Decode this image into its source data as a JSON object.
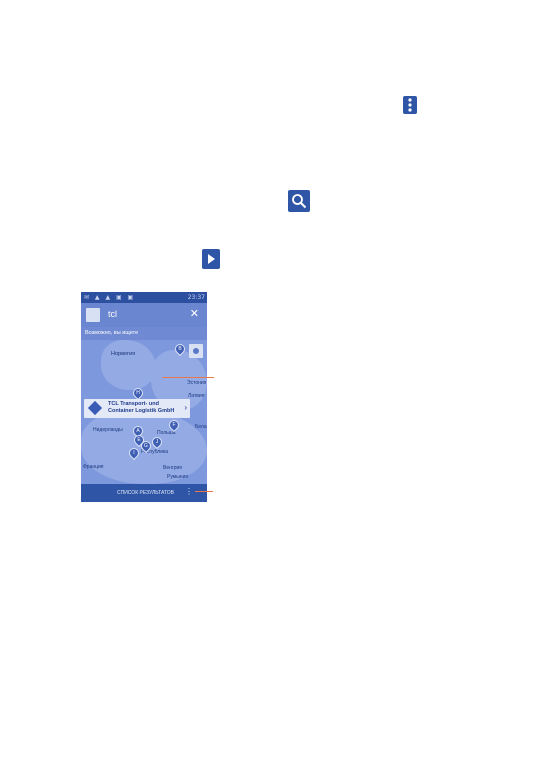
{
  "colors": {
    "accent": "#2f56a6",
    "map_water": "#7d98dc",
    "map_land": "#93aae4",
    "callout": "#e8784a"
  },
  "icons": {
    "menu": "vertical-dots-icon",
    "search": "magnifier-icon",
    "play": "play-triangle-icon"
  },
  "phone": {
    "status": {
      "time": "23:37"
    },
    "search": {
      "query": "tcl"
    },
    "suggestions_label": "Возможно, вы ищете",
    "map": {
      "labels": {
        "norway": "Норвегия",
        "estonia": "Эстония",
        "latvia": "Латвия",
        "netherlands": "Нидерланды",
        "poland": "Польша",
        "republic": "Республика",
        "france": "Франция",
        "hungary": "Венгрия",
        "romania": "Румыния",
        "belarus": "Бела"
      },
      "pins": [
        "B",
        "H",
        "A",
        "E",
        "G",
        "J",
        "I",
        "F"
      ]
    },
    "info_card": {
      "line1": "TCL Transport- und",
      "line2": "Container Logistik GmbH"
    },
    "bottom_label": "СПИСОК РЕЗУЛЬТАТОВ"
  }
}
